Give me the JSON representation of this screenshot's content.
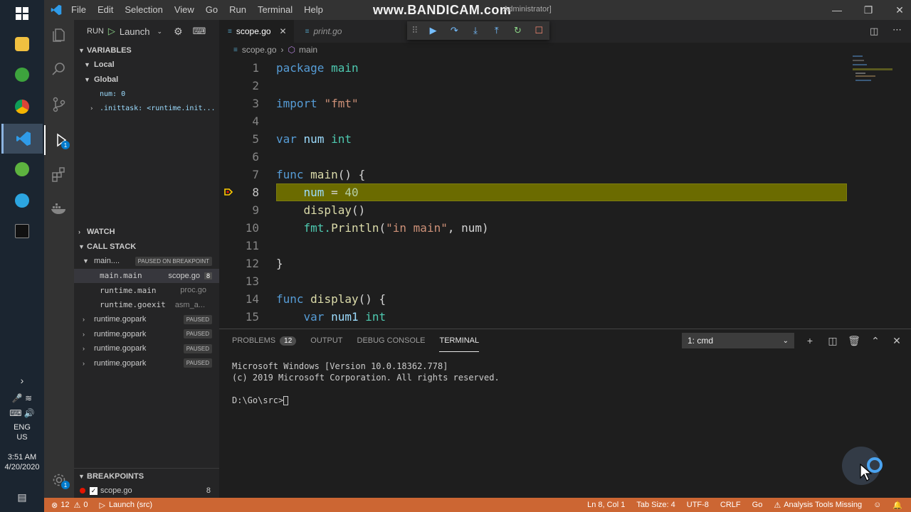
{
  "watermark": "www.BANDICAM.com",
  "title_suffix": "Administrator]",
  "menu": [
    "File",
    "Edit",
    "Selection",
    "View",
    "Go",
    "Run",
    "Terminal",
    "Help"
  ],
  "taskbar": {
    "language": "ENG",
    "region": "US",
    "time": "3:51 AM",
    "date": "4/20/2020"
  },
  "run_view": {
    "title": "RUN",
    "config": "Launch"
  },
  "variables": {
    "header": "VARIABLES",
    "local_label": "Local",
    "global_label": "Global",
    "num_entry": "num: 0",
    "inittask_entry": ".inittask: <runtime.init..."
  },
  "watch": {
    "header": "WATCH"
  },
  "call_stack": {
    "header": "CALL STACK",
    "main_thread": "main....",
    "main_status": "PAUSED ON BREAKPOINT",
    "frames": [
      {
        "fn": "main.main",
        "src": "scope.go",
        "line": "8"
      },
      {
        "fn": "runtime.main",
        "src": "proc.go",
        "line": ""
      },
      {
        "fn": "runtime.goexit",
        "src": "asm_a...",
        "line": ""
      }
    ],
    "threads": [
      {
        "name": "runtime.gopark",
        "status": "PAUSED"
      },
      {
        "name": "runtime.gopark",
        "status": "PAUSED"
      },
      {
        "name": "runtime.gopark",
        "status": "PAUSED"
      },
      {
        "name": "runtime.gopark",
        "status": "PAUSED"
      }
    ]
  },
  "breakpoints": {
    "header": "BREAKPOINTS",
    "items": [
      {
        "file": "scope.go",
        "line": "8"
      }
    ]
  },
  "tabs": [
    {
      "label": "scope.go"
    },
    {
      "label": "print.go"
    }
  ],
  "breadcrumb": {
    "file": "scope.go",
    "symbol": "main"
  },
  "code_lines": [
    {
      "n": "1"
    },
    {
      "n": "2"
    },
    {
      "n": "3"
    },
    {
      "n": "4"
    },
    {
      "n": "5"
    },
    {
      "n": "6"
    },
    {
      "n": "7"
    },
    {
      "n": "8"
    },
    {
      "n": "9"
    },
    {
      "n": "10"
    },
    {
      "n": "11"
    },
    {
      "n": "12"
    },
    {
      "n": "13"
    },
    {
      "n": "14"
    },
    {
      "n": "15"
    }
  ],
  "code": {
    "l1_kw": "package",
    "l1_name": "main",
    "l3_kw": "import",
    "l3_str": "\"fmt\"",
    "l5_kw": "var",
    "l5_name": "num",
    "l5_type": "int",
    "l7_kw": "func",
    "l7_fn": "main",
    "l7_rest": "() {",
    "l8_var": "num",
    "l8_op": " = ",
    "l8_num": "40",
    "l9_fn": "display",
    "l9_rest": "()",
    "l10_pkg": "fmt.",
    "l10_fn": "Println",
    "l10_open": "(",
    "l10_str": "\"in main\"",
    "l10_rest": ", num)",
    "l12": "}",
    "l14_kw": "func",
    "l14_fn": "display",
    "l14_rest": "() {",
    "l15_kw": "var",
    "l15_name": "num1",
    "l15_type": "int"
  },
  "panel": {
    "tabs": {
      "problems": "PROBLEMS",
      "problems_count": "12",
      "output": "OUTPUT",
      "debug": "DEBUG CONSOLE",
      "terminal": "TERMINAL"
    },
    "terminal_select": "1: cmd",
    "terminal_lines": [
      "Microsoft Windows [Version 10.0.18362.778]",
      "(c) 2019 Microsoft Corporation. All rights reserved.",
      "",
      "D:\\Go\\src>"
    ]
  },
  "status": {
    "errors": "12",
    "warnings": "0",
    "launch": "Launch (src)",
    "position": "Ln 8, Col 1",
    "tab_size": "Tab Size: 4",
    "encoding": "UTF-8",
    "eol": "CRLF",
    "language": "Go",
    "analysis": "Analysis Tools Missing"
  },
  "colors": {
    "statusbar": "#cc6633",
    "highlight_line": "#6b6b00",
    "accent": "#007acc"
  }
}
